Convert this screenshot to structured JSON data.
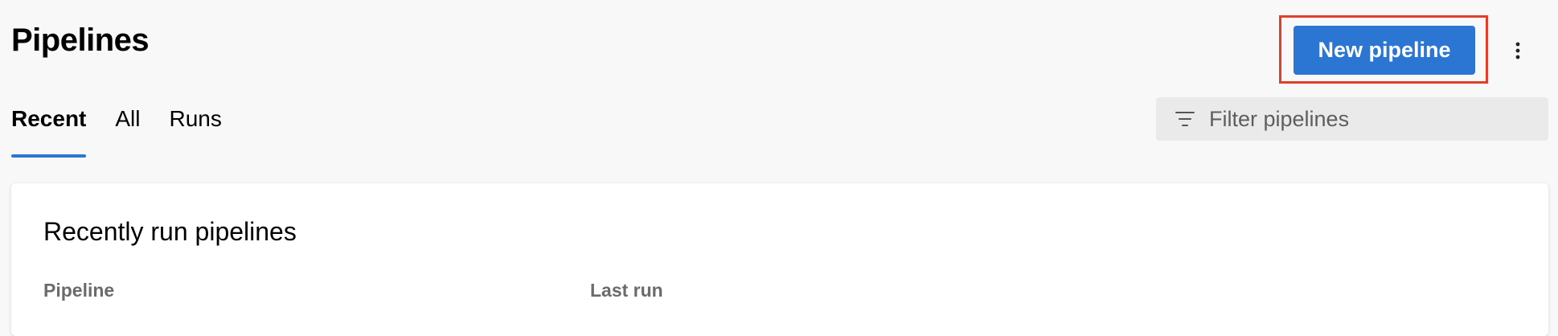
{
  "header": {
    "title": "Pipelines",
    "new_pipeline_label": "New pipeline",
    "more_icon": "more-vertical-icon"
  },
  "tabs": [
    {
      "label": "Recent",
      "active": true
    },
    {
      "label": "All",
      "active": false
    },
    {
      "label": "Runs",
      "active": false
    }
  ],
  "filter": {
    "icon": "filter-icon",
    "placeholder": "Filter pipelines",
    "value": ""
  },
  "card": {
    "title": "Recently run pipelines",
    "columns": [
      "Pipeline",
      "Last run"
    ]
  },
  "colors": {
    "accent": "#2b76d2",
    "highlight": "#e0402b",
    "background": "#f8f8f8"
  }
}
